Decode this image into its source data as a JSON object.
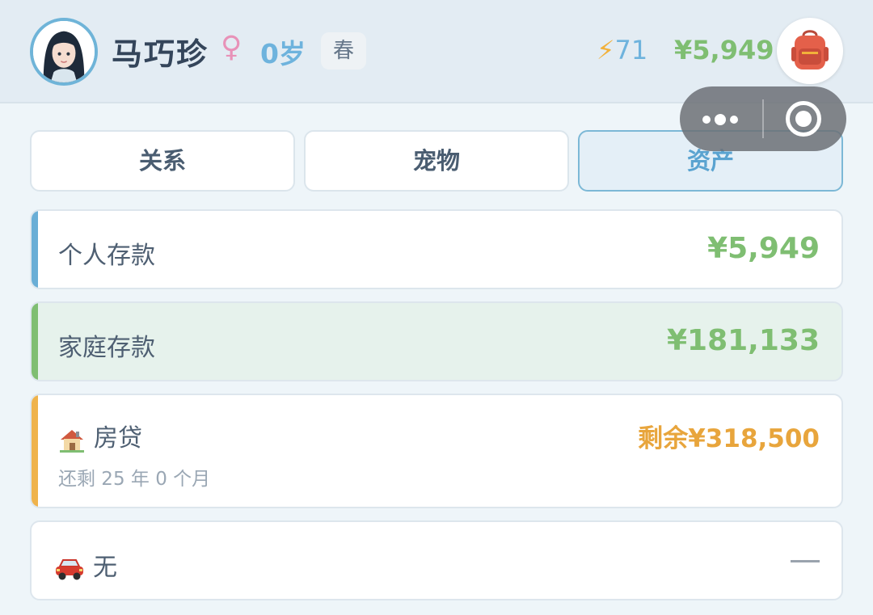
{
  "profile": {
    "name": "马巧珍",
    "gender_symbol": "♀",
    "age": "0岁",
    "season": "春"
  },
  "stats": {
    "energy_icon": "⚡",
    "energy": "71",
    "money": "¥5,949"
  },
  "tabs": [
    {
      "label": "关系",
      "active": false
    },
    {
      "label": "宠物",
      "active": false
    },
    {
      "label": "资产",
      "active": true
    }
  ],
  "assets": {
    "personal_savings": {
      "label": "个人存款",
      "value": "¥5,949"
    },
    "family_savings": {
      "label": "家庭存款",
      "value": "¥181,133"
    },
    "mortgage": {
      "icon": "house-icon",
      "label": "房贷",
      "value": "剩余¥318,500",
      "remaining_term": "还剩 25 年 0 个月"
    },
    "car": {
      "icon": "car-icon",
      "label": "无",
      "value": "—"
    }
  },
  "colors": {
    "accent_blue": "#6eb3dd",
    "money_green": "#7fbe72",
    "loan_orange": "#e8a53c",
    "female_pink": "#e892b8"
  }
}
